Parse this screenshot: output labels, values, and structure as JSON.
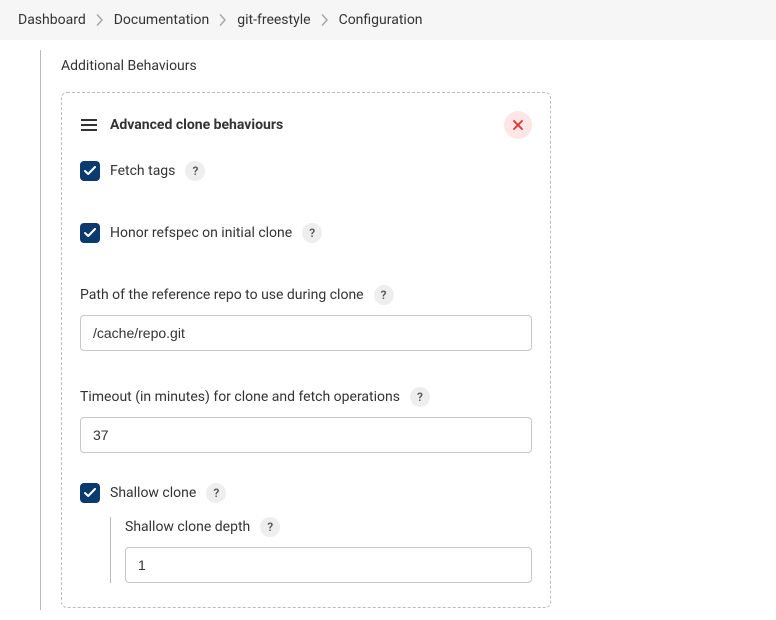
{
  "breadcrumbs": {
    "items": [
      "Dashboard",
      "Documentation",
      "git-freestyle",
      "Configuration"
    ]
  },
  "section": {
    "title": "Additional Behaviours"
  },
  "panel": {
    "title": "Advanced clone behaviours"
  },
  "fields": {
    "fetch_tags": {
      "label": "Fetch tags",
      "checked": true
    },
    "honor_refspec": {
      "label": "Honor refspec on initial clone",
      "checked": true
    },
    "reference_path": {
      "label": "Path of the reference repo to use during clone",
      "value": "/cache/repo.git"
    },
    "timeout": {
      "label": "Timeout (in minutes) for clone and fetch operations",
      "value": "37"
    },
    "shallow": {
      "label": "Shallow clone",
      "checked": true,
      "depth_label": "Shallow clone depth",
      "depth_value": "1"
    }
  },
  "help_glyph": "?"
}
